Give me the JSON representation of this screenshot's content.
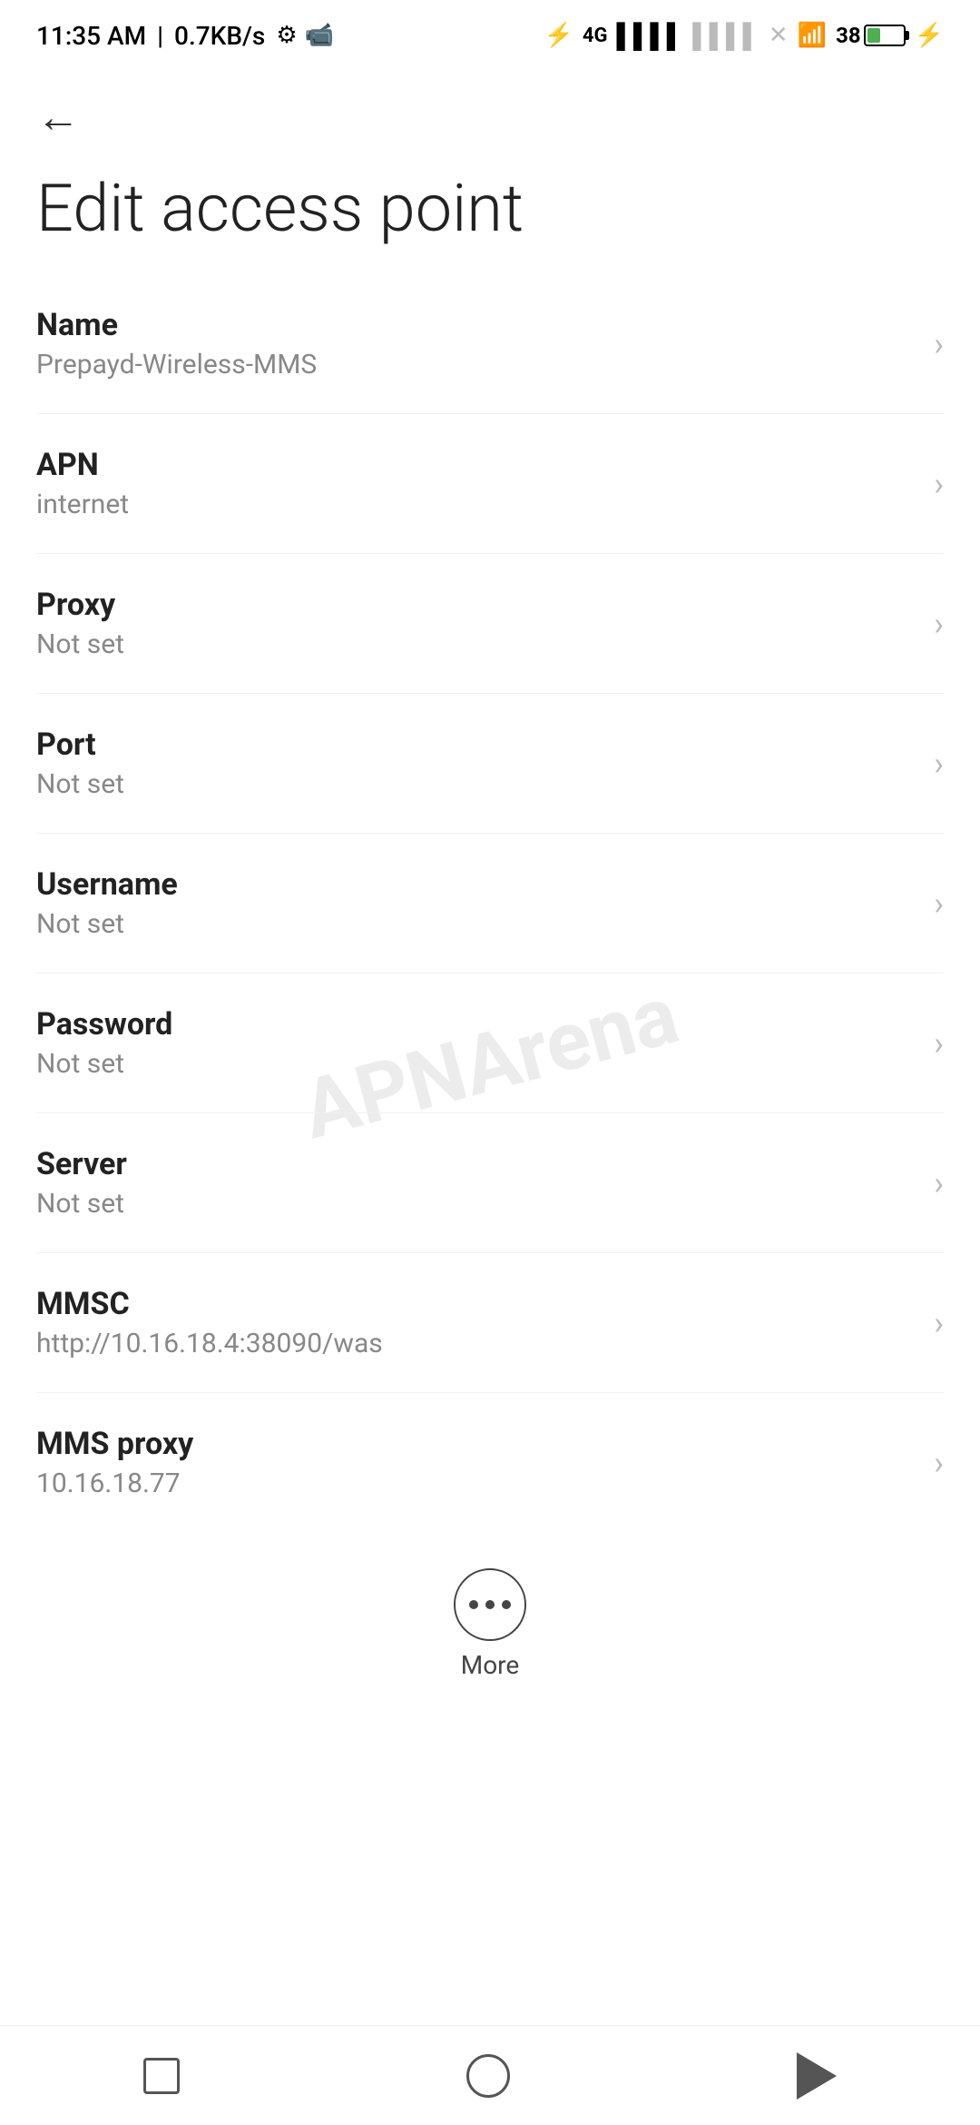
{
  "statusBar": {
    "time": "11:35 AM",
    "speed": "0.7KB/s"
  },
  "header": {
    "backLabel": "←",
    "title": "Edit access point"
  },
  "settings": [
    {
      "label": "Name",
      "value": "Prepayd-Wireless-MMS"
    },
    {
      "label": "APN",
      "value": "internet"
    },
    {
      "label": "Proxy",
      "value": "Not set"
    },
    {
      "label": "Port",
      "value": "Not set"
    },
    {
      "label": "Username",
      "value": "Not set"
    },
    {
      "label": "Password",
      "value": "Not set"
    },
    {
      "label": "Server",
      "value": "Not set"
    },
    {
      "label": "MMSC",
      "value": "http://10.16.18.4:38090/was"
    },
    {
      "label": "MMS proxy",
      "value": "10.16.18.77"
    }
  ],
  "more": {
    "label": "More"
  },
  "watermark": "APNArena"
}
